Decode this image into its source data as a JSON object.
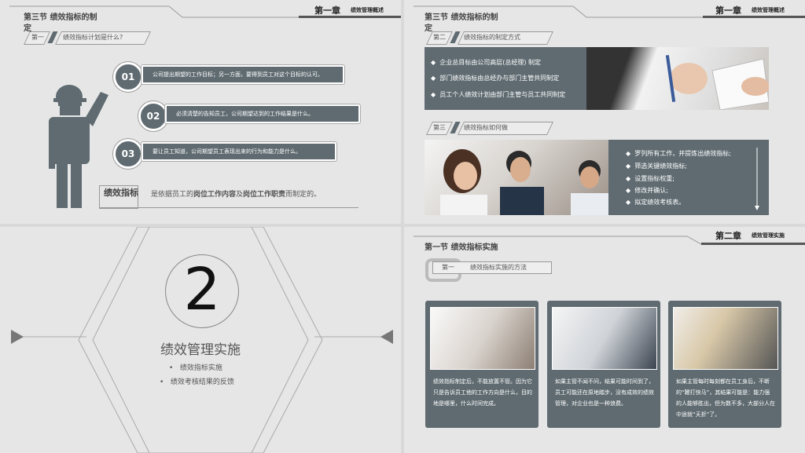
{
  "s1": {
    "section": "第三节  绩效指标的制定",
    "chapter": "第一章",
    "chapter_sub": "绩效管理概述",
    "tag_num": "第一",
    "tag_text": "绩效指标计划是什么?",
    "items": [
      {
        "num": "01",
        "text": "公司提出期望的工作目标；另一方面，要得到员工对这个目标的认可。"
      },
      {
        "num": "02",
        "text": "必须清楚的告知员工，公司期望达到的工作结果是什么。"
      },
      {
        "num": "03",
        "text": "要让员工知道，公司期望员工表现出来的行为和能力是什么。"
      }
    ],
    "def_label": "绩效指标",
    "def_a": "是依据员工的",
    "def_b": "岗位工作内容",
    "def_c": "及",
    "def_d": "岗位工作职责",
    "def_e": "而制定的。"
  },
  "s2": {
    "section": "第三节  绩效指标的制定",
    "chapter": "第一章",
    "chapter_sub": "绩效管理概述",
    "tag1_num": "第二",
    "tag1_text": "绩效指标的制定方式",
    "list1": [
      "企业总目标由公司高层(总经理) 制定",
      "部门绩效指标由总经办与部门主管共同制定",
      "员工个人绩效计划由部门主管与员工共同制定"
    ],
    "tag2_num": "第三",
    "tag2_text": "绩效指标如何做",
    "list2": [
      "罗列所有工作，并提炼出绩效指标;",
      "筛选关键绩效指标;",
      "设置指标权重;",
      "修改并确认;",
      "拟定绩效考核表。"
    ]
  },
  "s3": {
    "number": "2",
    "title": "绩效管理实施",
    "bullets": [
      "绩效指标实施",
      "绩效考核结果的反馈"
    ]
  },
  "s4": {
    "section": "第一节  绩效指标实施",
    "chapter": "第二章",
    "chapter_sub": "绩效管理实施",
    "tag_num": "第一",
    "tag_text": "绩效指标实施的方法",
    "cards": [
      "绩效指标制定后，不能放置不管。因为它只是告诉员工他的工作方向是什么，目的地是哪里，什么时间完成。",
      "如果主管不闻不问，结果可能时间到了，员工可能还在原地踏步，没有成效的绩效管理，对企业也是一种浪费。",
      "如果主管每时每刻都在员工身后，不断的“鞭打快马”，其结果可能是：能力强的人能够胜出，但为数不多，大部分人在中途就“夭折”了。"
    ]
  }
}
